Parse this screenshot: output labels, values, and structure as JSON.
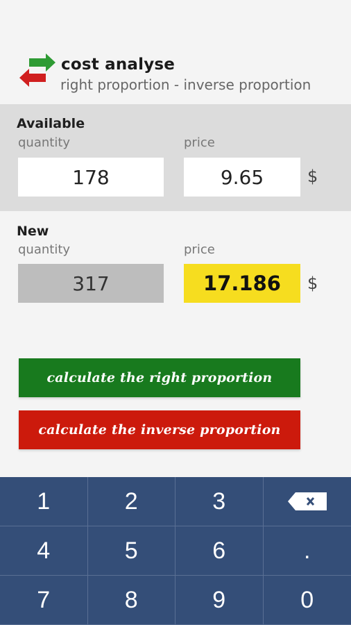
{
  "header": {
    "title": "cost analyse",
    "subtitle": "right proportion - inverse proportion",
    "logo_icon": "swap-arrows-icon",
    "colors": {
      "arrow_green": "#2e9b34",
      "arrow_red": "#d01f1f"
    }
  },
  "available": {
    "title": "Available",
    "quantity_label": "quantity",
    "price_label": "price",
    "quantity_value": "178",
    "price_value": "9.65",
    "currency": "$"
  },
  "new": {
    "title": "New",
    "quantity_label": "quantity",
    "price_label": "price",
    "quantity_value": "317",
    "price_value": "17.186",
    "currency": "$"
  },
  "buttons": {
    "right": "calculate the right proportion",
    "inverse": "calculate the inverse proportion",
    "colors": {
      "green": "#187a1e",
      "red": "#cc1a0c"
    }
  },
  "keypad": {
    "keys": [
      "1",
      "2",
      "3",
      "",
      "4",
      "5",
      "6",
      ".",
      "7",
      "8",
      "9",
      "0"
    ],
    "backspace_icon": "backspace-icon",
    "background": "#344e78"
  }
}
